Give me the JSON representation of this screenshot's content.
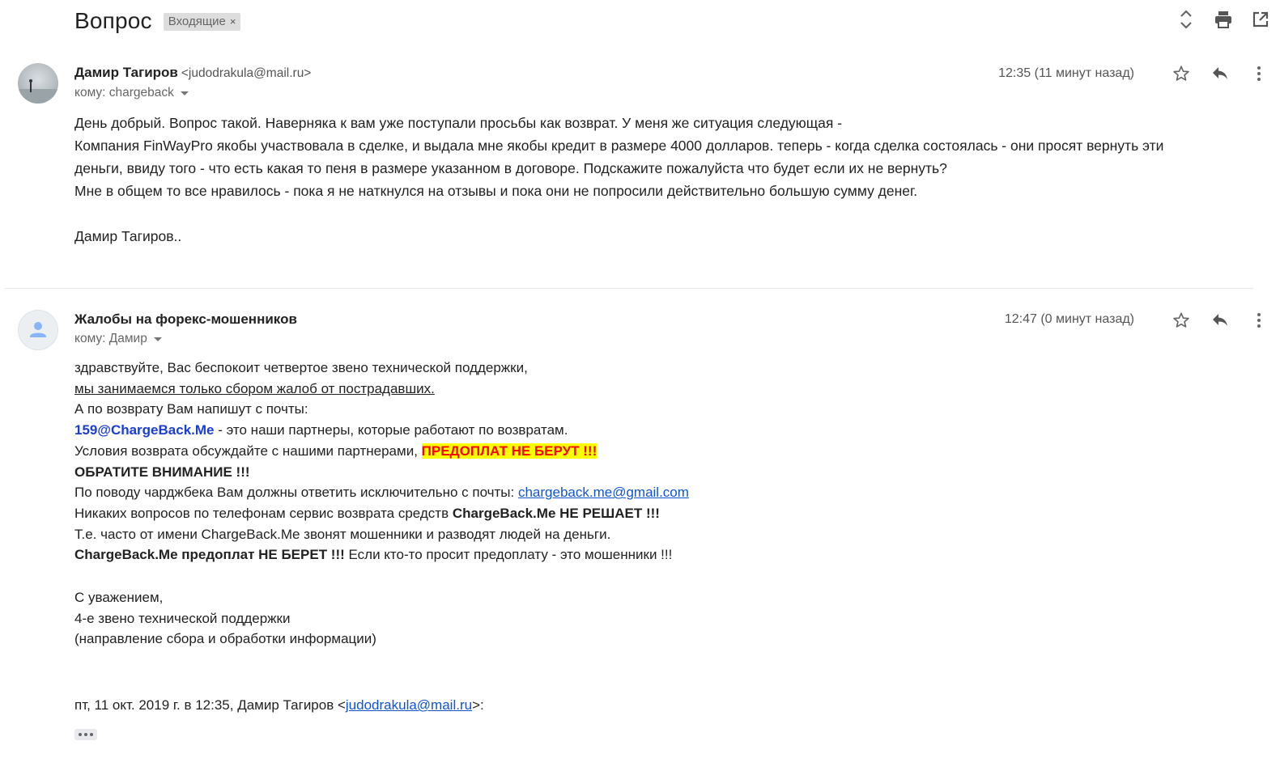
{
  "thread": {
    "subject": "Вопрос",
    "label": "Входящие",
    "label_close": "×",
    "icons": [
      "expand-collapse-icon",
      "print-icon",
      "open-in-new-window-icon"
    ]
  },
  "message1": {
    "sender_name": "Дамир Тагиров",
    "sender_email": "<judodrakula@mail.ru>",
    "to": "кому: chargeback",
    "time": "12:35 (11 минут назад)",
    "body": [
      "День добрый. Вопрос такой. Наверняка к вам уже поступали просьбы как возврат. У меня же ситуация следующая -",
      "Компания FinWayPro якобы участвовала в сделке, и выдала мне якобы кредит в размере 4000 долларов. теперь - когда сделка состоялась - они просят вернуть эти",
      "деньги, ввиду того - что есть какая то пеня в размере указанном в договоре. Подскажите пожалуйста что будет если их не вернуть?",
      "Мне в общем то все нравилось - пока я не наткнулся на отзывы и пока они не попросили действительно большую сумму денег.",
      "",
      "Дамир Тагиров.."
    ]
  },
  "message2": {
    "sender_name": "Жалобы на форекс-мошенников",
    "to": "кому: Дамир",
    "time": "12:47 (0 минут назад)",
    "lines": {
      "l1": "здравствуйте, Вас беспокоит четвертое звено технической поддержки,",
      "l2": "мы занимаемся только сбором жалоб от пострадавших.",
      "l3": "А по возврату Вам напишут с почты:",
      "l4_email": "159@ChargeBack.Me",
      "l4_rest": " - это наши партнеры, которые работают по возвратам.",
      "l5_text": "Условия возврата обсуждайте с нашими партнерами, ",
      "l5_highlight": "ПРЕДОПЛАТ НЕ БЕРУТ !!!",
      "l6": "ОБРАТИТЕ ВНИМАНИЕ !!!",
      "l7_text": "По поводу чарджбека Вам должны ответить исключительно с почты: ",
      "l7_link": "chargeback.me@gmail.com",
      "l8_text": "Никаких вопросов по телефонам сервис возврата средств ",
      "l8_bold": "ChargeBack.Me НЕ РЕШАЕТ !!!",
      "l9": "Т.е. часто от имени ChargeBack.Me звонят мошенники и разводят людей на деньги.",
      "l10_bold": "ChargeBack.Me предоплат НЕ БЕРЕТ !!!",
      "l10_rest": " Если кто-то просит предоплату - это мошенники !!!",
      "l11": "С уважением,",
      "l12": "4-е звено технической поддержки",
      "l13": "(направление сбора и обработки информации)",
      "quote_prefix": "пт, 11 окт. 2019 г. в 12:35, Дамир Тагиров <",
      "quote_link": "judodrakula@mail.ru",
      "quote_suffix": ">:"
    }
  }
}
